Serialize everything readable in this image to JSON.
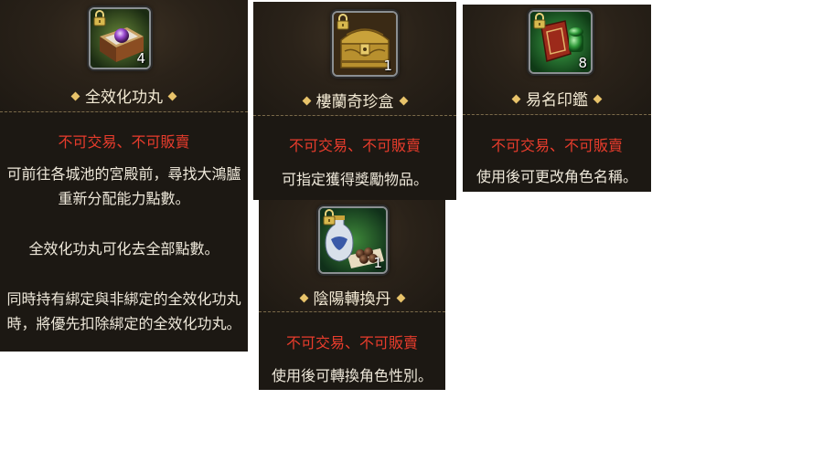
{
  "items": [
    {
      "name": "全效化功丸",
      "quantity": "4",
      "restriction": "不可交易、不可販賣",
      "description": [
        "可前往各城池的宮殿前，尋找大鴻臚重新分配能力點數。",
        "全效化功丸可化去全部點數。",
        "同時持有綁定與非綁定的全效化功丸時，將優先扣除綁定的全效化功丸。"
      ],
      "icon": "pearl-box-icon"
    },
    {
      "name": "樓蘭奇珍盒",
      "quantity": "1",
      "restriction": "不可交易、不可販賣",
      "description": [
        "可指定獲得獎勵物品。"
      ],
      "icon": "treasure-chest-icon"
    },
    {
      "name": "易名印鑑",
      "quantity": "8",
      "restriction": "不可交易、不可販賣",
      "description": [
        "使用後可更改角色名稱。"
      ],
      "icon": "seal-icon"
    },
    {
      "name": "陰陽轉換丹",
      "quantity": "1",
      "restriction": "不可交易、不可販賣",
      "description": [
        "使用後可轉換角色性別。"
      ],
      "icon": "vase-pills-icon"
    }
  ],
  "colors": {
    "restriction": "#e83c2c",
    "name": "#f3ead4",
    "text": "#eee8da",
    "panel": "#1c1813",
    "accent": "#e8c36a"
  }
}
